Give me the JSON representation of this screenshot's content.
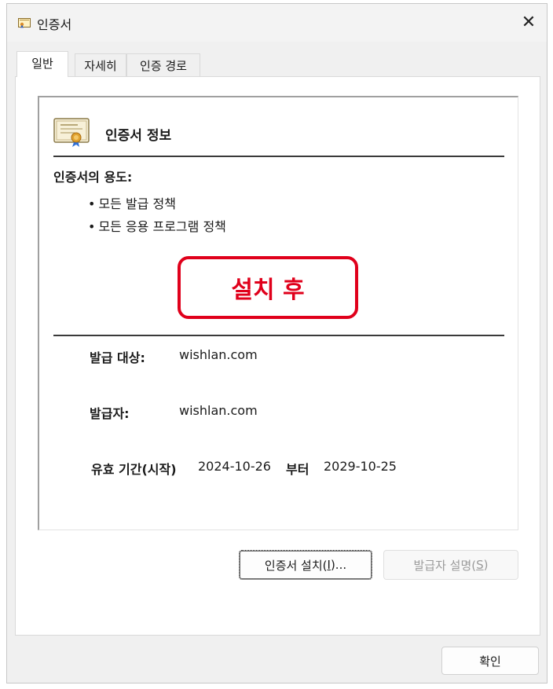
{
  "window": {
    "title": "인증서",
    "close_glyph": "✕"
  },
  "tabs": [
    {
      "label": "일반",
      "active": true
    },
    {
      "label": "자세히",
      "active": false
    },
    {
      "label": "인증 경로",
      "active": false
    }
  ],
  "certificate": {
    "info_heading": "인증서 정보",
    "purposes_heading": "인증서의 용도:",
    "purposes": [
      "모든 발급 정책",
      "모든 응용 프로그램 정책"
    ],
    "annotation": "설치 후",
    "issued_to_label": "발급 대상:",
    "issued_to_value": "wishlan.com",
    "issued_by_label": "발급자:",
    "issued_by_value": "wishlan.com",
    "validity_label": "유효 기간(시작)",
    "valid_from": "2024-10-26",
    "validity_to_label": "부터",
    "valid_to": "2029-10-25"
  },
  "buttons": {
    "install_prefix": "인증서 설치(",
    "install_mnemonic": "I",
    "install_suffix": ")...",
    "issuer_prefix": "발급자 설명(",
    "issuer_mnemonic": "S",
    "issuer_suffix": ")",
    "ok": "확인"
  },
  "colors": {
    "annotation_red": "#e0001b",
    "dialog_bg": "#f0f0f0"
  },
  "icons": [
    "certificate-icon",
    "close-icon"
  ]
}
